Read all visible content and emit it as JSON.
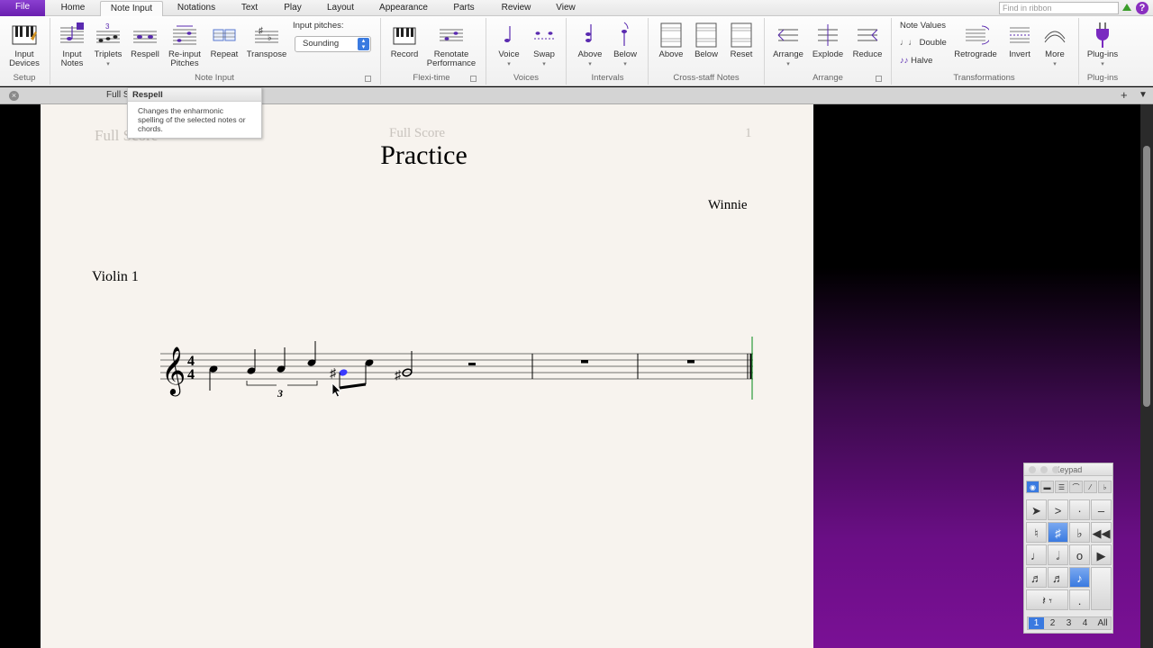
{
  "menu": {
    "tabs": [
      "File",
      "Home",
      "Note Input",
      "Notations",
      "Text",
      "Play",
      "Layout",
      "Appearance",
      "Parts",
      "Review",
      "View"
    ],
    "active_tab": "Note Input",
    "search_placeholder": "Find in ribbon"
  },
  "ribbon": {
    "buttons": {
      "input_devices": "Input\nDevices",
      "input_notes": "Input\nNotes",
      "triplets": "Triplets",
      "respell": "Respell",
      "reinput": "Re-input\nPitches",
      "repeat": "Repeat",
      "transpose": "Transpose",
      "record": "Record",
      "renotate": "Renotate\nPerformance",
      "voice": "Voice",
      "swap": "Swap",
      "above": "Above",
      "below": "Below",
      "cs_above": "Above",
      "cs_below": "Below",
      "cs_reset": "Reset",
      "arrange": "Arrange",
      "explode": "Explode",
      "reduce": "Reduce",
      "retrograde": "Retrograde",
      "invert": "Invert",
      "more": "More",
      "plugins": "Plug-ins"
    },
    "input_pitches_label": "Input pitches:",
    "input_pitches_value": "Sounding",
    "note_values_label": "Note Values",
    "double_label": "Double",
    "halve_label": "Halve",
    "groups": {
      "setup": "Setup",
      "note_input": "Note Input",
      "flexi_time": "Flexi-time",
      "voices": "Voices",
      "intervals": "Intervals",
      "cross_staff": "Cross-staff Notes",
      "arrange": "Arrange",
      "transformations": "Transformations",
      "plugins": "Plug-ins"
    }
  },
  "document_tab": "Full S",
  "tooltip": {
    "title": "Respell",
    "body": "Changes the enharmonic spelling of the selected notes or chords."
  },
  "score": {
    "header_left": "Full Score",
    "header_center": "Full Score",
    "page_number": "1",
    "title": "Practice",
    "composer": "Winnie",
    "instrument": "Violin 1",
    "time_signature": "4/4",
    "tuplet_number": "3"
  },
  "keypad": {
    "title": "Keypad",
    "layouts": [
      "1",
      "2",
      "3",
      "4",
      "All"
    ],
    "active_layout": "1"
  },
  "colors": {
    "accent": "#6a1fb0",
    "selection": "#3a3aff",
    "background_gradient": "#7a1095"
  }
}
